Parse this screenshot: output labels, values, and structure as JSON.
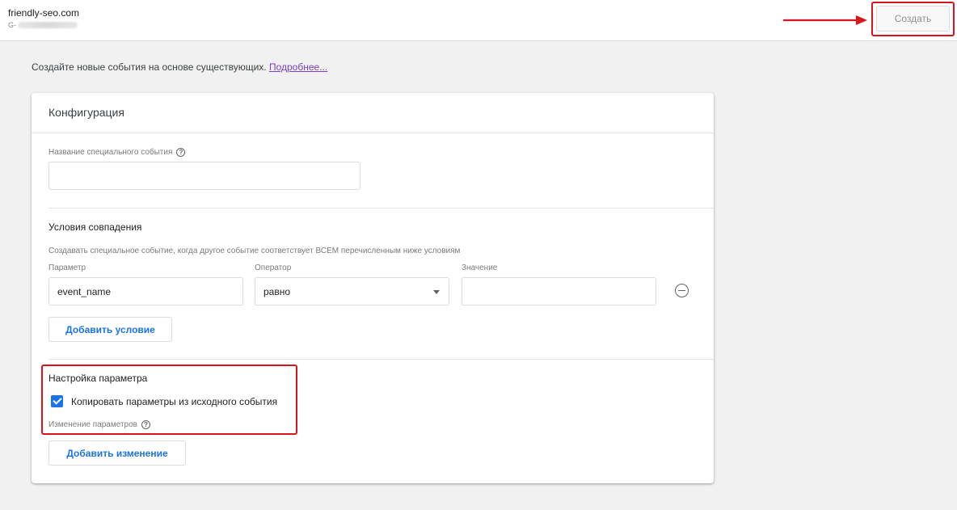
{
  "header": {
    "site_name": "friendly-seo.com",
    "site_id_prefix": "G-",
    "create_label": "Создать"
  },
  "intro": {
    "text": "Создайте новые события на основе существующих.",
    "link": "Подробнее..."
  },
  "card": {
    "title": "Конфигурация",
    "event_name_label": "Название специального события",
    "event_name_value": "",
    "conditions": {
      "title": "Условия совпадения",
      "description": "Создавать специальное событие, когда другое событие соответствует ВСЕМ перечисленным ниже условиям",
      "param_label": "Параметр",
      "operator_label": "Оператор",
      "value_label": "Значение",
      "param_value": "event_name",
      "operator_value": "равно",
      "value_value": "",
      "add_condition": "Добавить условие"
    },
    "params": {
      "title": "Настройка параметра",
      "copy_label": "Копировать параметры из исходного события",
      "copy_checked": true,
      "modify_label": "Изменение параметров",
      "add_modification": "Добавить изменение"
    }
  },
  "colors": {
    "accent": "#1a73e8",
    "highlight": "#d9151b",
    "link": "#7b3fc3"
  },
  "icons": [
    "help-icon",
    "remove-circle-icon",
    "dropdown-arrow-icon",
    "checkbox-checked-icon",
    "arrow-right-icon"
  ]
}
